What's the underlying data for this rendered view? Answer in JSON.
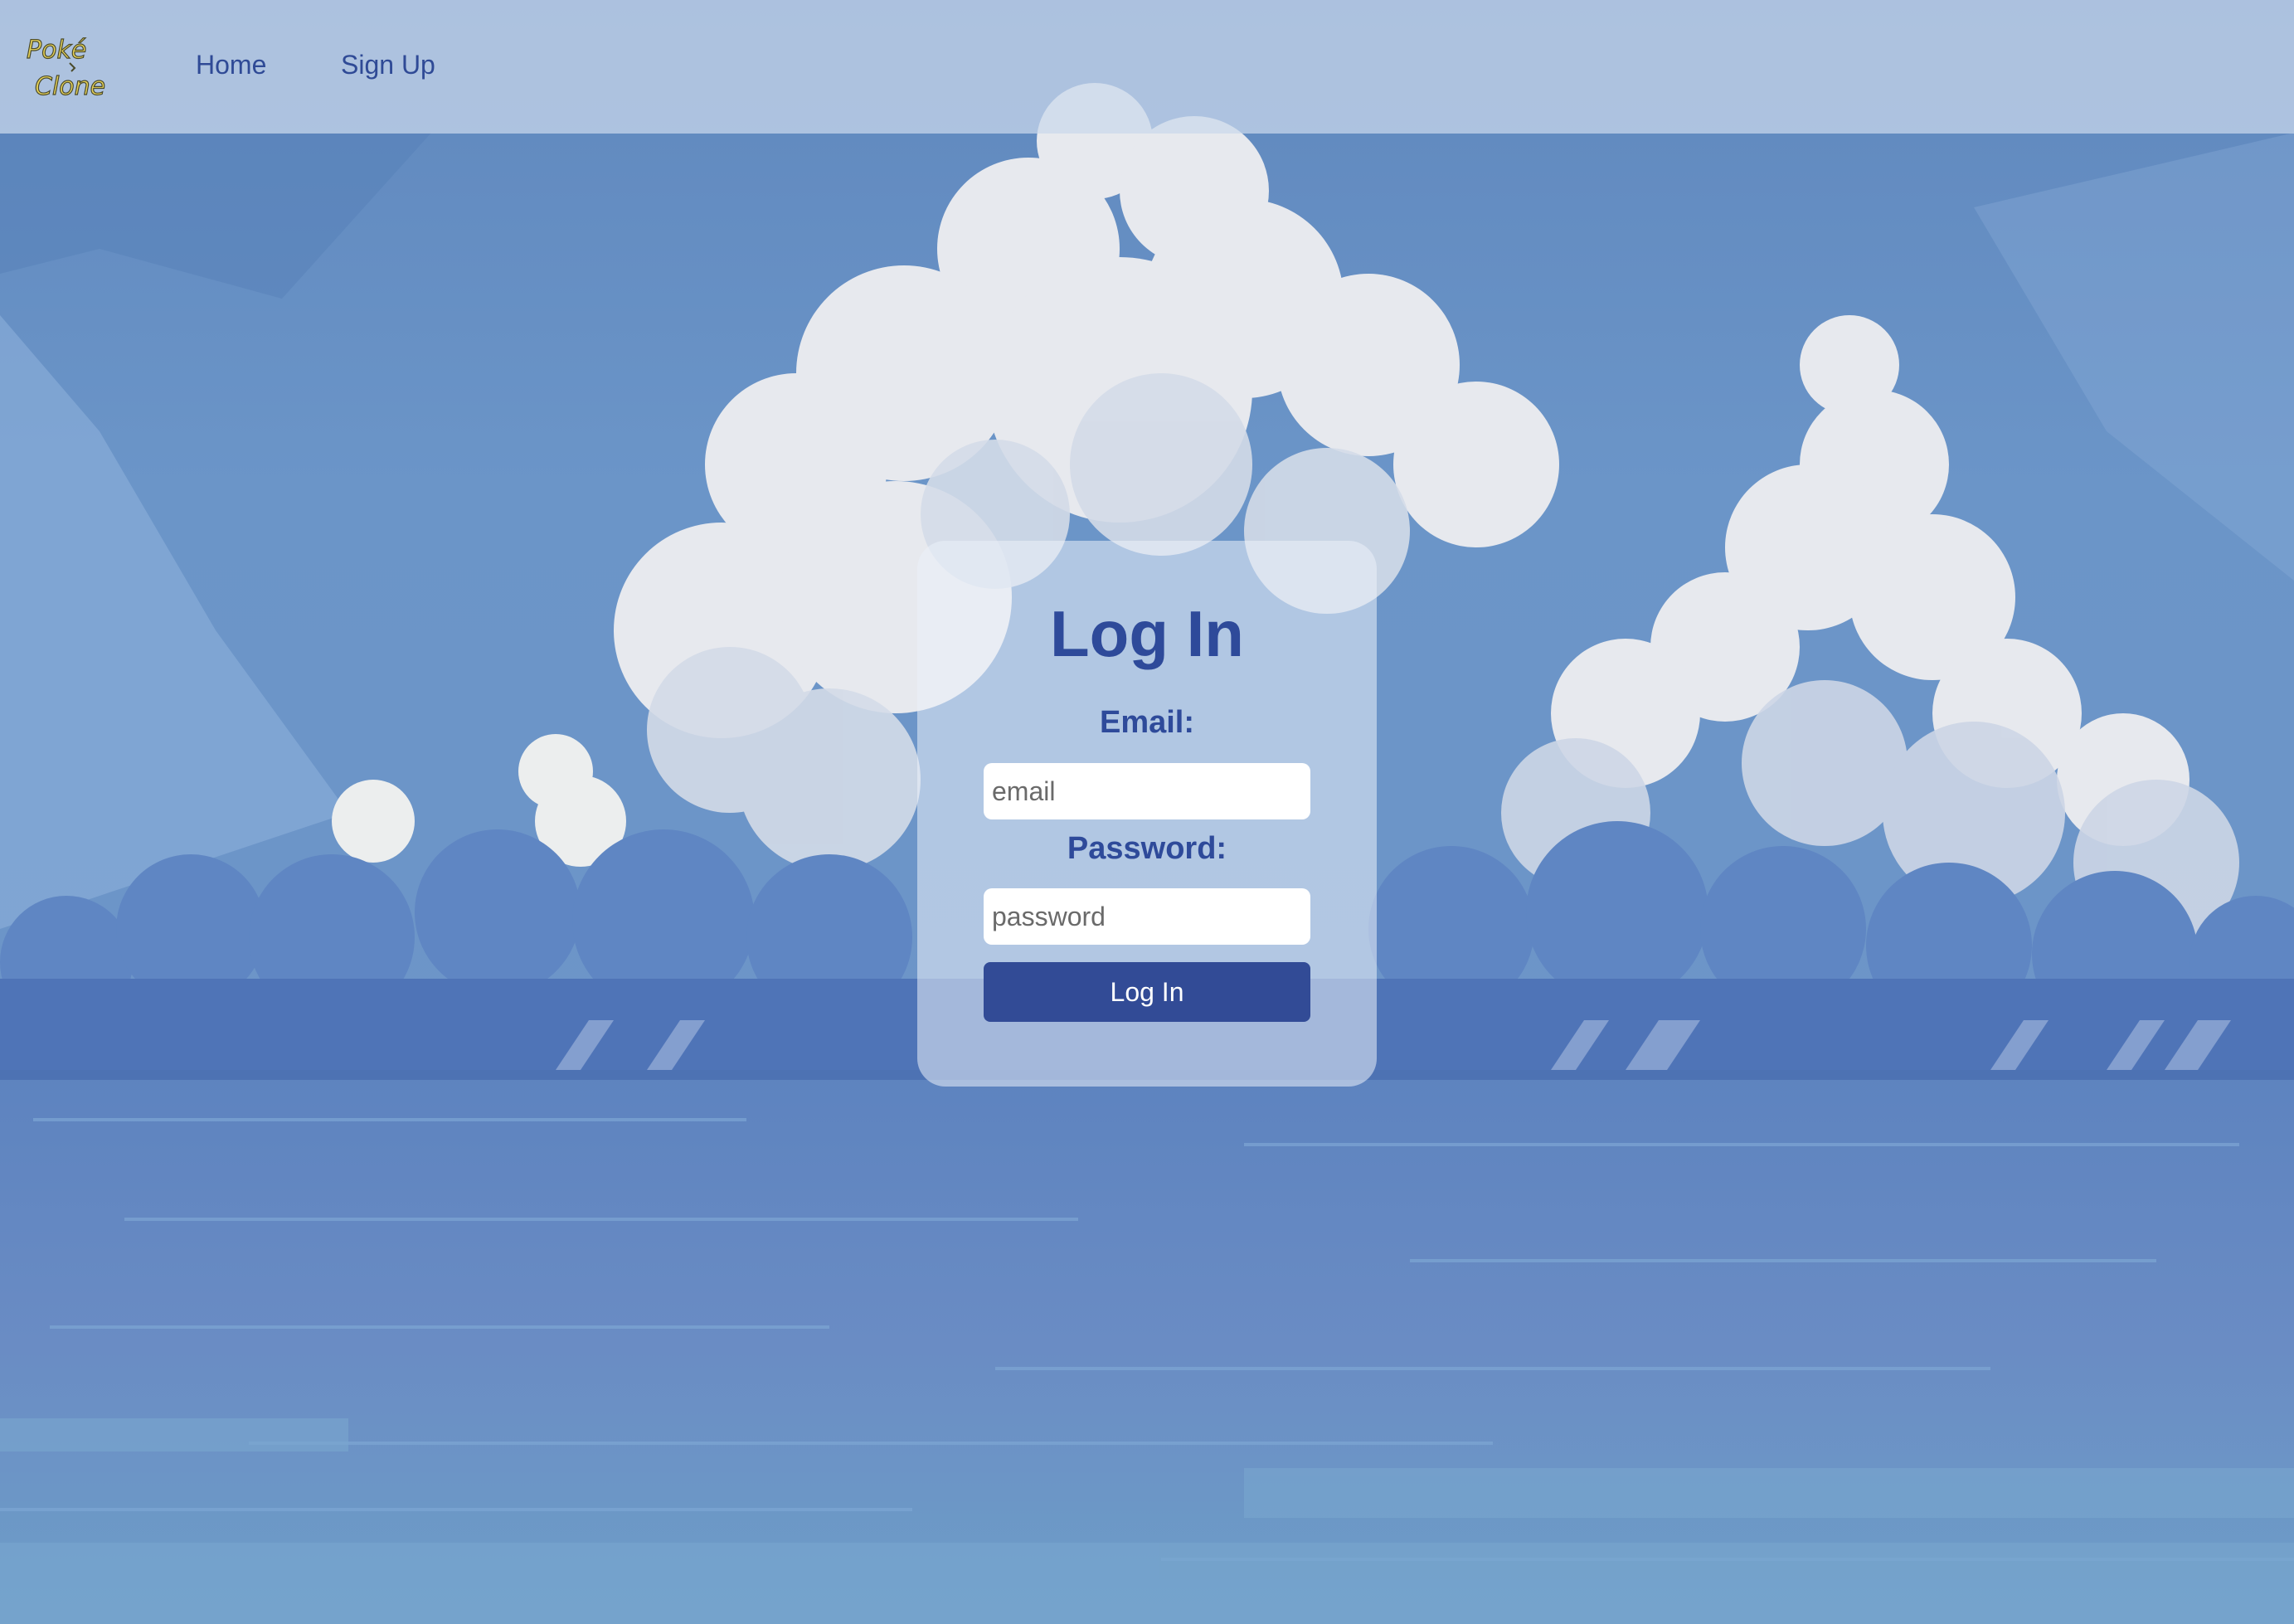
{
  "nav": {
    "logo_text_line1": "Poké",
    "logo_text_line2": "Clone",
    "links": [
      {
        "label": "Home"
      },
      {
        "label": "Sign Up"
      }
    ]
  },
  "login": {
    "title": "Log In",
    "email_label": "Email:",
    "email_placeholder": "email",
    "email_value": "",
    "password_label": "Password:",
    "password_placeholder": "password",
    "password_value": "",
    "submit_label": "Log In"
  },
  "colors": {
    "accent": "#324b96",
    "heading": "#2e4a9a",
    "sky": "#6a8fc4",
    "logo_yellow": "#e8d35a"
  },
  "icons": {
    "logo": "poke-clone-logo"
  }
}
